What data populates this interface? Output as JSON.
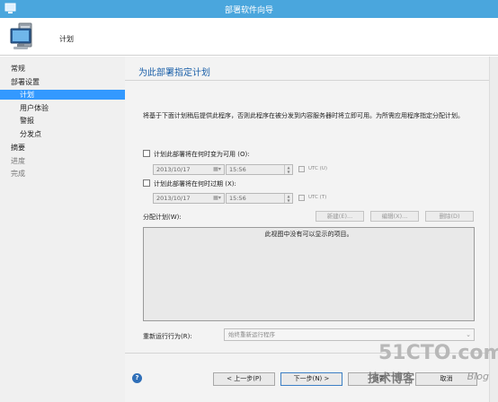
{
  "window": {
    "title": "部署软件向导"
  },
  "header": {
    "title": "计划"
  },
  "sidebar": {
    "items": [
      {
        "label": "常规"
      },
      {
        "label": "部署设置"
      },
      {
        "label": "计划"
      },
      {
        "label": "用户体验"
      },
      {
        "label": "警报"
      },
      {
        "label": "分发点"
      },
      {
        "label": "摘要"
      },
      {
        "label": "进度"
      },
      {
        "label": "完成"
      }
    ]
  },
  "main": {
    "title": "为此部署指定计划",
    "description": "将基于下面计划稍后提供此程序，否则此程序在被分发到内容服务器时将立即可用。为所需应用程序指定分配计划。",
    "available": {
      "label": "计划此部署将在何时变为可用 (O):",
      "date": "2013/10/17",
      "time": "15:56",
      "utc_label": "UTC (U)"
    },
    "expire": {
      "label": "计划此部署将在何时过期 (X):",
      "date": "2013/10/17",
      "time": "15:56",
      "utc_label": "UTC (T)"
    },
    "assignment": {
      "label": "分配计划(W):",
      "new_label": "新建(E)...",
      "edit_label": "编辑(X)...",
      "delete_label": "删除(D)",
      "empty_text": "此视图中没有可以显示的项目。"
    },
    "rerun": {
      "label": "重新运行行为(R):",
      "value": "始终重新运行程序"
    }
  },
  "footer": {
    "prev_label": "< 上一步(P)",
    "next_label": "下一步(N) >",
    "summary_label": "摘要",
    "cancel_label": "取消"
  },
  "watermark": {
    "big": "51CTO.com",
    "small": "技术博客",
    "blog": "Blog"
  },
  "colors": {
    "titlebar": "#4aa6dd",
    "selected": "#3399ff",
    "heading": "#1a5fa8"
  },
  "icons": [
    "app-icon",
    "computer-icon",
    "calendar-icon",
    "spinner-icon",
    "chevron-down-icon",
    "help-icon"
  ]
}
